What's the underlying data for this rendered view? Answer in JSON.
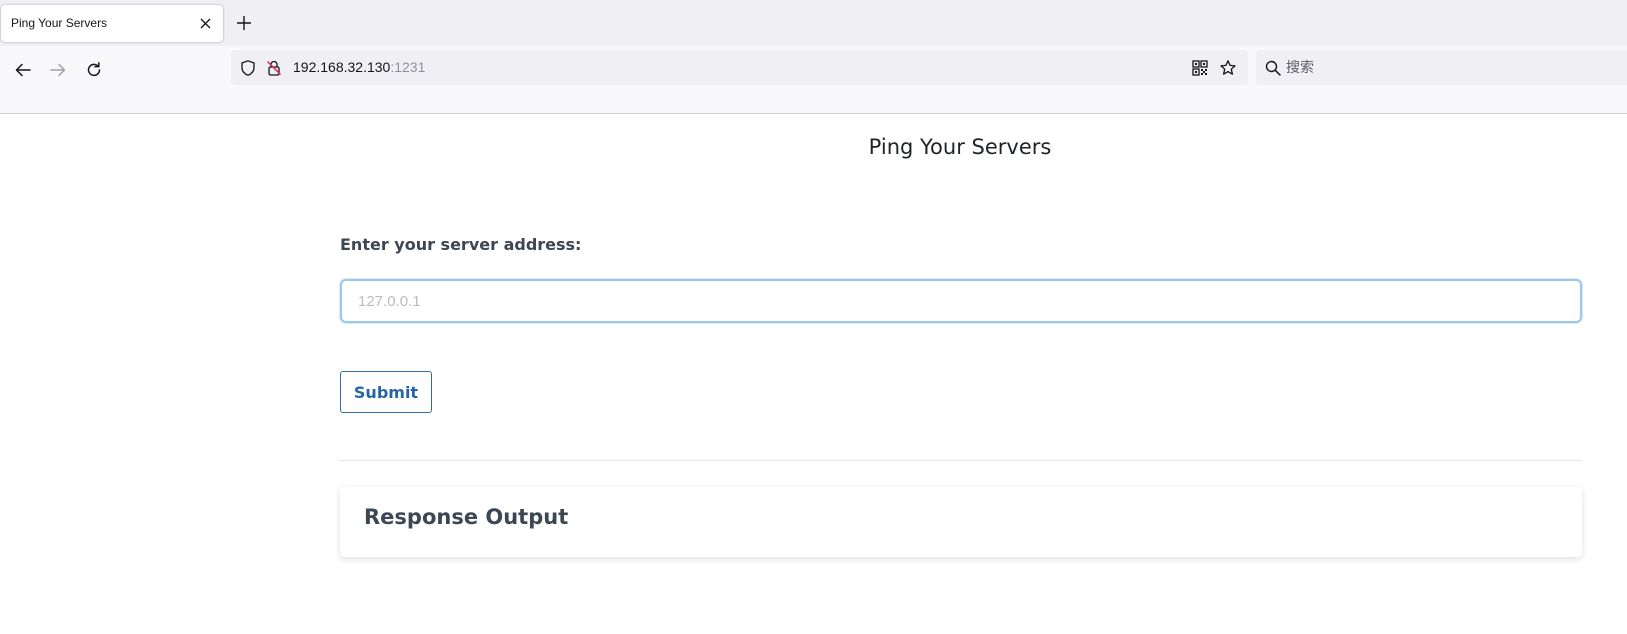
{
  "browser": {
    "tab": {
      "title": "Ping Your Servers"
    },
    "urlbar": {
      "host": "192.168.32.130",
      "port": ":1231"
    },
    "searchbar": {
      "placeholder": "搜索"
    }
  },
  "page": {
    "title": "Ping Your Servers",
    "form": {
      "label": "Enter your server address:",
      "input_placeholder": "127.0.0.1",
      "input_value": "",
      "submit_label": "Submit"
    },
    "output": {
      "title": "Response Output"
    }
  },
  "icons": {
    "tab_close": "close-icon",
    "new_tab": "plus-icon",
    "back": "arrow-left-icon",
    "forward": "arrow-right-icon",
    "reload": "reload-icon",
    "tracking_protection": "shield-icon",
    "insecure": "insecure-lock-icon",
    "qr_code": "qr-code-icon",
    "bookmark": "star-icon",
    "search": "search-icon"
  },
  "colors": {
    "accent": "#2a65a3",
    "input_focus": "#9fc8e8",
    "text_dark": "#3d4753"
  }
}
